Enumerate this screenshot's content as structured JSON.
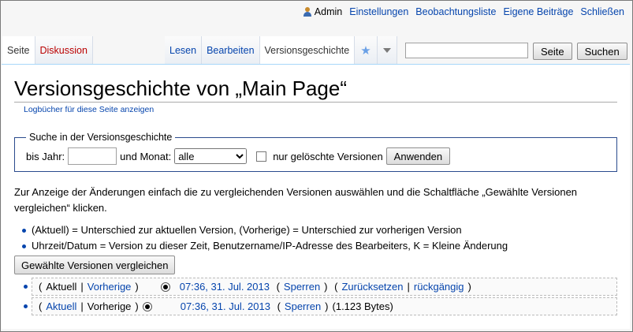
{
  "personal": {
    "user": "Admin",
    "links": [
      "Einstellungen",
      "Beobachtungsliste",
      "Eigene Beiträge",
      "Schließen"
    ]
  },
  "tabs": {
    "left": [
      "Seite",
      "Diskussion"
    ],
    "right": [
      "Lesen",
      "Bearbeiten",
      "Versionsgeschichte"
    ]
  },
  "search": {
    "value": "",
    "button_page": "Seite",
    "button_search": "Suchen"
  },
  "page": {
    "title": "Versionsgeschichte von „Main Page“",
    "sublink": "Logbücher für diese Seite anzeigen"
  },
  "filter": {
    "legend": "Suche in der Versionsgeschichte",
    "year_label": "bis Jahr:",
    "year_value": "",
    "month_label": "und Monat:",
    "month_value": "alle",
    "deleted_label": "nur gelöschte Versionen",
    "apply_button": "Anwenden"
  },
  "info": {
    "text": "Zur Anzeige der Änderungen einfach die zu vergleichenden Versionen auswählen und die Schaltfläche „Gewählte Versionen vergleichen“ klicken.",
    "legend_items": [
      "(Aktuell) = Unterschied zur aktuellen Version, (Vorherige) = Unterschied zur vorherigen Version",
      "Uhrzeit/Datum = Version zu dieser Zeit, Benutzername/IP-Adresse des Bearbeiters, K = Kleine Änderung"
    ],
    "compare_button": "Gewählte Versionen vergleichen"
  },
  "history": [
    {
      "cur": "Aktuell",
      "prev": "Vorherige",
      "sep": "|",
      "timestamp": "07:36, 31. Jul. 2013",
      "block": "Sperren",
      "reset": "Zurücksetzen",
      "undo": "rückgängig"
    },
    {
      "cur": "Aktuell",
      "prev": "Vorherige",
      "sep": "|",
      "timestamp": "07:36, 31. Jul. 2013",
      "block": "Sperren",
      "size": "(1.123 Bytes)"
    }
  ]
}
